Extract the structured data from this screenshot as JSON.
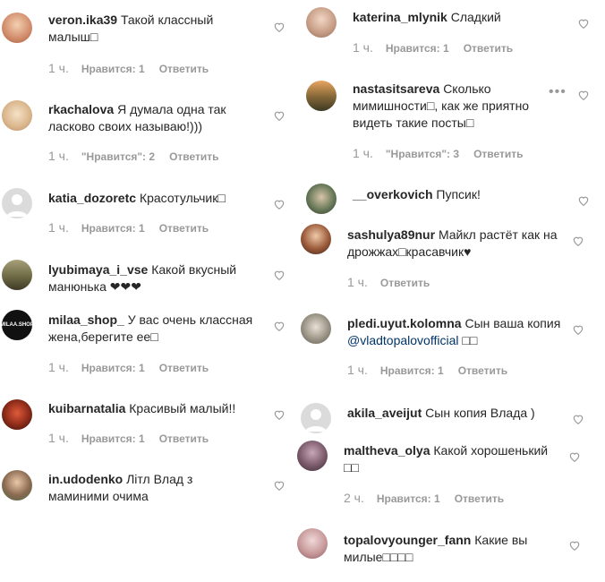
{
  "comments": [
    {
      "user": "veron.ika39",
      "text": "Такой классный малыш□",
      "time": "1 ч.",
      "likes": "Нравится: 1",
      "reply": "Ответить"
    },
    {
      "user": "rkachalova",
      "text": "Я думала одна так ласково своих называю!)))",
      "time": "1 ч.",
      "likes": "\"Нравится\": 2",
      "reply": "Ответить"
    },
    {
      "user": "katia_dozoretc",
      "text": "Красотульчик□",
      "time": "1 ч.",
      "likes": "Нравится: 1",
      "reply": "Ответить"
    },
    {
      "user": "lyubimaya_i_vse",
      "text": "Какой вкусный манюнька ❤❤❤",
      "time": "",
      "likes": "",
      "reply": ""
    },
    {
      "user": "milaa_shop_",
      "text": "У вас очень классная жена,берегите ее□",
      "time": "1 ч.",
      "likes": "Нравится: 1",
      "reply": "Ответить"
    },
    {
      "user": "kuibarnatalia",
      "text": "Красивый малый!!",
      "time": "1 ч.",
      "likes": "Нравится: 1",
      "reply": "Ответить"
    },
    {
      "user": "in.udodenko",
      "text": "Літл Влад з маминими очима",
      "time": "",
      "likes": "",
      "reply": ""
    },
    {
      "user": "katerina_mlynik",
      "text": "Сладкий",
      "time": "1 ч.",
      "likes": "Нравится: 1",
      "reply": "Ответить"
    },
    {
      "user": "nastasitsareva",
      "text": "Сколько мимишности□, как же приятно видеть такие посты□",
      "time": "1 ч.",
      "likes": "\"Нравится\": 3",
      "reply": "Ответить"
    },
    {
      "user": "__overkovich",
      "text": "Пупсик!",
      "time": "",
      "likes": "",
      "reply": ""
    },
    {
      "user": "sashulya89nur",
      "text": "Майкл растёт как на дрожжах□красавчик♥",
      "time": "1 ч.",
      "likes": "",
      "reply": "Ответить"
    },
    {
      "user": "pledi.uyut.kolomna",
      "text": "Сын ваша копия",
      "mention": "@vladtopalovofficial",
      "text_after": " □□",
      "time": "1 ч.",
      "likes": "Нравится: 1",
      "reply": "Ответить"
    },
    {
      "user": "akila_aveijut",
      "text": "Сын копия Влада )",
      "time": "",
      "likes": "",
      "reply": ""
    },
    {
      "user": "maltheva_olya",
      "text": "Какой хорошенький □□",
      "time": "2 ч.",
      "likes": "Нравится: 1",
      "reply": "Ответить"
    },
    {
      "user": "topalovyounger_fann",
      "text": "Какие вы милые□□□□",
      "time": "",
      "likes": "",
      "reply": ""
    }
  ],
  "more_icon": "more-horizontal-icon",
  "heart_icon": "heart-outline-icon",
  "heart_color": "#c7c7c7"
}
